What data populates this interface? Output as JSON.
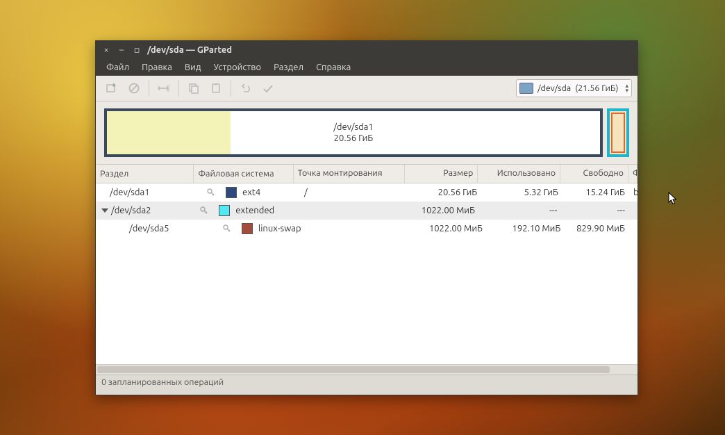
{
  "window": {
    "title": "/dev/sda — GParted",
    "menus": [
      "Файл",
      "Правка",
      "Вид",
      "Устройство",
      "Раздел",
      "Справка"
    ],
    "disk_selector": {
      "device": "/dev/sda",
      "size": "(21.56 ГиБ)"
    }
  },
  "diagram": {
    "main_label_line1": "/dev/sda1",
    "main_label_line2": "20.56 ГиБ"
  },
  "columns": {
    "partition": "Раздел",
    "filesystem": "Файловая система",
    "mount": "Точка монтирования",
    "size": "Размер",
    "used": "Использовано",
    "free": "Свободно",
    "flags": "Флаги"
  },
  "rows": [
    {
      "indent": 0,
      "expander": false,
      "name": "/dev/sda1",
      "locked": true,
      "fs": "ext4",
      "fs_color": "#2e4a7d",
      "mount": "/",
      "size": "20.56 ГиБ",
      "used": "5.32 ГиБ",
      "free": "15.24 ГиБ",
      "flags": "boot"
    },
    {
      "indent": 0,
      "expander": true,
      "name": "/dev/sda2",
      "locked": true,
      "fs": "extended",
      "fs_color": "#55e7f2",
      "mount": "",
      "size": "1022.00 МиБ",
      "used": "---",
      "free": "---",
      "flags": ""
    },
    {
      "indent": 1,
      "expander": false,
      "name": "/dev/sda5",
      "locked": true,
      "fs": "linux-swap",
      "fs_color": "#a44b3b",
      "mount": "",
      "size": "1022.00 МиБ",
      "used": "192.10 МиБ",
      "free": "829.90 МиБ",
      "flags": ""
    }
  ],
  "status": "0 запланированных операций"
}
